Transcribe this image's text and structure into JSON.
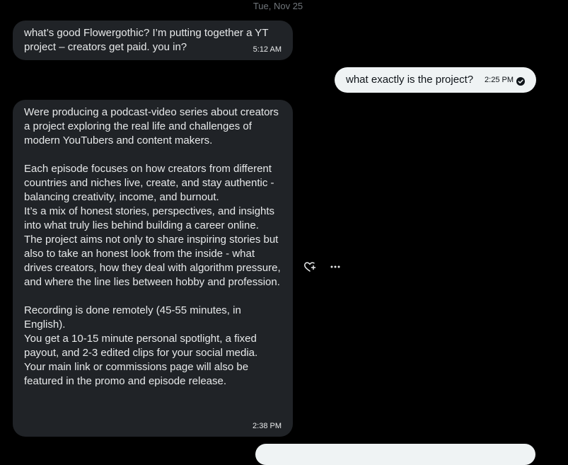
{
  "conversation": {
    "date_separator": "Tue, Nov 25",
    "messages": [
      {
        "direction": "incoming",
        "text": "what’s good Flowergothic? I’m putting together a YT project – creators get paid. you in?",
        "time": "5:12 AM"
      },
      {
        "direction": "outgoing",
        "text": "what exactly is the project?",
        "time": "2:25 PM",
        "status_icon": "read-check-icon"
      },
      {
        "direction": "incoming",
        "text": "Were producing a podcast-video series about creators a project exploring the real life and challenges of modern YouTubers and content makers.\n\nEach episode focuses on how creators from different countries and niches live, create, and stay authentic - balancing creativity, income, and burnout.\nIt’s a mix of honest stories, perspectives, and insights into what truly lies behind building a career online.\nThe project aims not only to share inspiring stories but also to take an honest look from the inside - what drives creators, how they deal with algorithm pressure, and where the line lies between hobby and profession.\n\nRecording is done remotely (45-55 minutes, in English).\nYou get a 10-15 minute personal spotlight, a fixed payout, and 2-3 edited clips for your social media.\nYour main link or commissions page will also be featured in the promo and episode release.",
        "time": "2:38 PM"
      }
    ],
    "hover_actions": {
      "react_icon": "heart-plus-icon",
      "more_icon": "more-horizontal-icon"
    }
  },
  "colors": {
    "background": "#000000",
    "incoming_bubble": "#202327",
    "outgoing_bubble": "#eff3f4",
    "muted_text": "#71767b"
  }
}
